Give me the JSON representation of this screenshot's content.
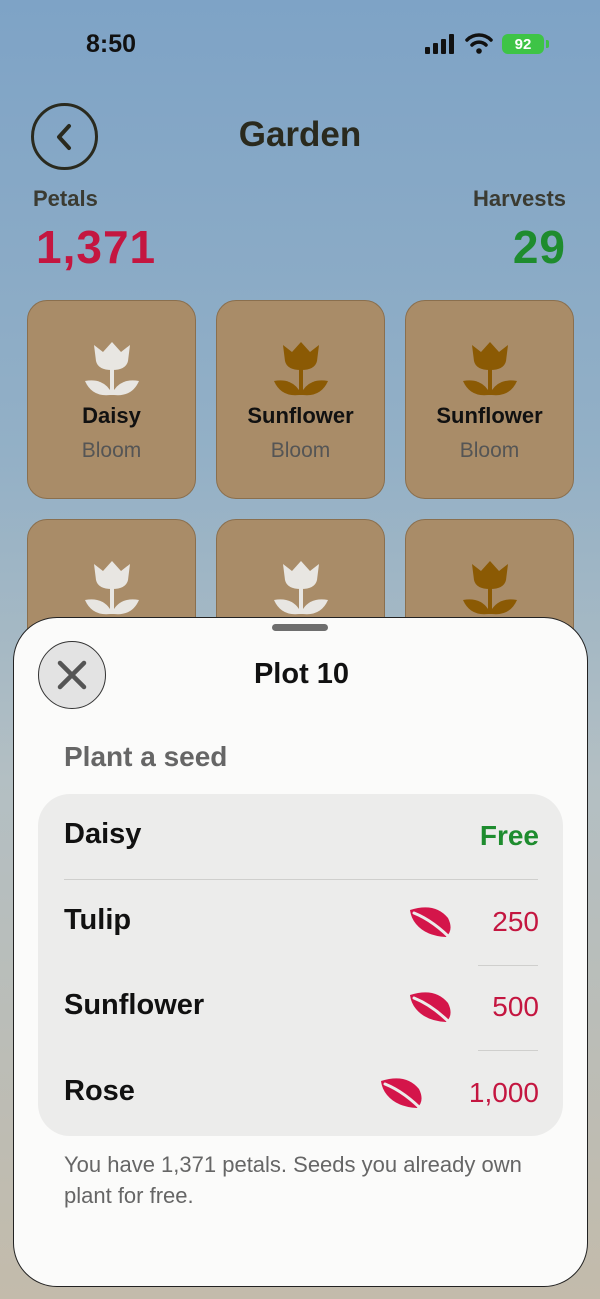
{
  "status": {
    "time": "8:50",
    "battery": "92"
  },
  "header": {
    "title": "Garden",
    "back_icon": "chevron-left-icon"
  },
  "stats": {
    "petals_label": "Petals",
    "petals_value": "1,371",
    "harvests_label": "Harvests",
    "harvests_value": "29"
  },
  "colors": {
    "petals": "#c41640",
    "harvests": "#1e8c2e",
    "plot": "#a98c68",
    "flower_white": "#e8e6e2",
    "flower_gold": "#8b5a04"
  },
  "plots": [
    {
      "name": "Daisy",
      "stage": "Bloom",
      "icon": "tulip-icon",
      "color": "#e8e6e2"
    },
    {
      "name": "Sunflower",
      "stage": "Bloom",
      "icon": "tulip-icon",
      "color": "#8b5a04"
    },
    {
      "name": "Sunflower",
      "stage": "Bloom",
      "icon": "tulip-icon",
      "color": "#8b5a04"
    },
    {
      "icon": "tulip-icon",
      "color": "#e8e6e2"
    },
    {
      "icon": "tulip-icon",
      "color": "#e8e6e2"
    },
    {
      "icon": "tulip-icon",
      "color": "#8b5a04"
    }
  ],
  "sheet": {
    "title": "Plot 10",
    "close_icon": "close-icon",
    "section_header": "Plant a seed",
    "seeds": [
      {
        "name": "Daisy",
        "price": "Free"
      },
      {
        "name": "Tulip",
        "price": "250",
        "icon": "leaf-icon"
      },
      {
        "name": "Sunflower",
        "price": "500",
        "icon": "leaf-icon"
      },
      {
        "name": "Rose",
        "price": "1,000",
        "icon": "leaf-icon"
      }
    ],
    "footnote": "You have 1,371 petals. Seeds you already own plant for free."
  }
}
